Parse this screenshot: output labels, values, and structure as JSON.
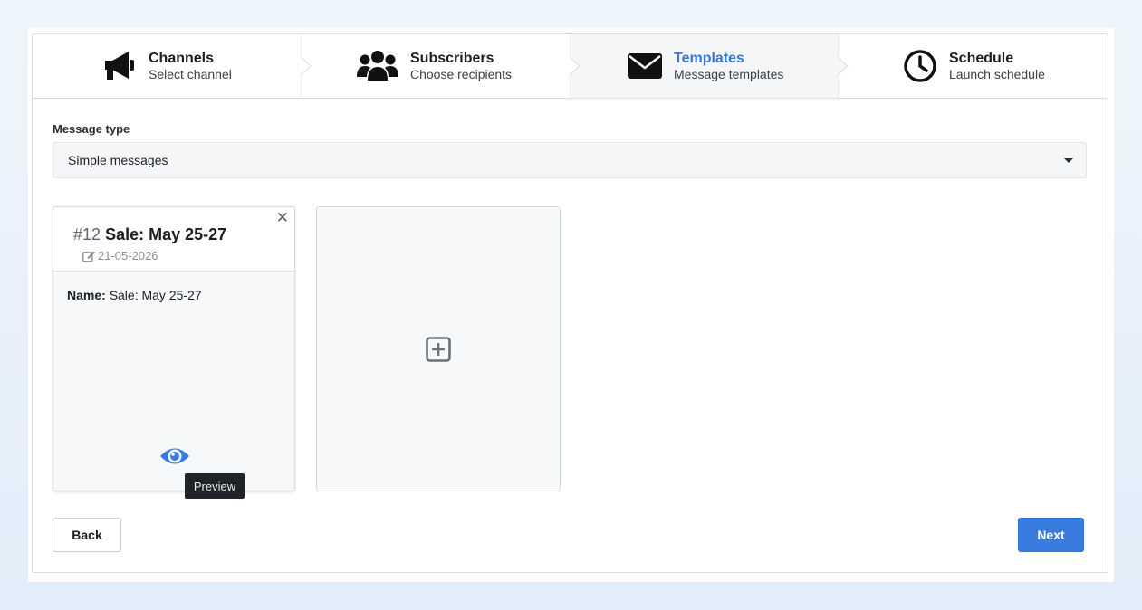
{
  "stepper": {
    "steps": [
      {
        "title": "Channels",
        "subtitle": "Select channel",
        "icon": "megaphone-icon"
      },
      {
        "title": "Subscribers",
        "subtitle": "Choose recipients",
        "icon": "users-icon"
      },
      {
        "title": "Templates",
        "subtitle": "Message templates",
        "icon": "envelope-icon"
      },
      {
        "title": "Schedule",
        "subtitle": "Launch schedule",
        "icon": "clock-icon"
      }
    ],
    "active_index": 2,
    "active_color": "#3a76d6"
  },
  "form": {
    "message_type_label": "Message type",
    "message_type_value": "Simple messages"
  },
  "template_card": {
    "number": "#12",
    "title": "Sale: May 25-27",
    "date": "21-05-2026",
    "name_label": "Name:",
    "name_value": "Sale: May 25-27",
    "close_symbol": "✕",
    "preview_tooltip": "Preview"
  },
  "actions": {
    "back_label": "Back",
    "next_label": "Next",
    "next_color": "#3a7be0"
  }
}
